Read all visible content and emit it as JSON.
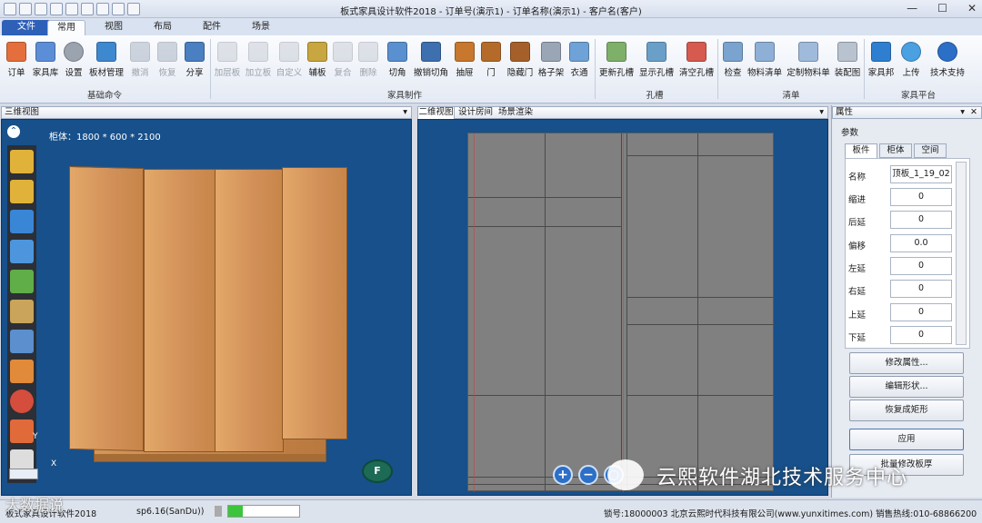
{
  "window": {
    "title": "板式家具设计软件2018 - 订单号(演示1) - 订单名称(演示1) - 客户名(客户)"
  },
  "tabs": [
    "文件",
    "常用",
    "视图",
    "布局",
    "配件",
    "场景"
  ],
  "ribbon": {
    "buttons": [
      "订单",
      "家具库",
      "设置",
      "板材管理",
      "撤消",
      "恢复",
      "分享",
      "加层板",
      "加立板",
      "自定义",
      "辅板",
      "复合",
      "删除",
      "切角",
      "撤销切角",
      "抽屉",
      "门",
      "隐藏门",
      "格子架",
      "衣通",
      "更新孔槽",
      "显示孔槽",
      "清空孔槽",
      "检查",
      "物料清单",
      "定制物料单",
      "装配图",
      "家具邦",
      "上传",
      "技术支持"
    ],
    "groups": [
      "基础命令",
      "家具制作",
      "孔槽",
      "清单",
      "家具平台"
    ]
  },
  "view3d": {
    "header": "三维视图",
    "dims": "柜体：1800 * 600 * 2100",
    "axis_x": "X",
    "axis_y": "Y",
    "compass": "F"
  },
  "view2d": {
    "tabs": [
      "二维视图",
      "设计房间",
      "场景渲染"
    ]
  },
  "props": {
    "header": "属性",
    "section": "参数",
    "tabs": [
      "板件",
      "柜体",
      "空间"
    ],
    "rows": [
      {
        "label": "名称",
        "value": "顶板_1_19_02"
      },
      {
        "label": "缩进",
        "value": "0"
      },
      {
        "label": "后延",
        "value": "0"
      },
      {
        "label": "偏移",
        "value": "0.0"
      },
      {
        "label": "左延",
        "value": "0"
      },
      {
        "label": "右延",
        "value": "0"
      },
      {
        "label": "上延",
        "value": "0"
      },
      {
        "label": "下延",
        "value": "0"
      }
    ],
    "buttons": [
      "修改属性...",
      "编辑形状...",
      "恢复成矩形",
      "应用",
      "批量修改板厚"
    ]
  },
  "status": {
    "left": "板式家具设计软件2018",
    "version": "sp6.16(SanDu))",
    "right": "锁号:18000003 北京云熙时代科技有限公司(www.yunxitimes.com)  销售热线:010-68866200"
  },
  "watermark": {
    "text": "云熙软件湖北技术服务中心",
    "corner": "大数据说"
  },
  "colors": {
    "viewport_bg": "#17508a",
    "wood": "#d29159",
    "file_tab": "#2e60b8"
  }
}
